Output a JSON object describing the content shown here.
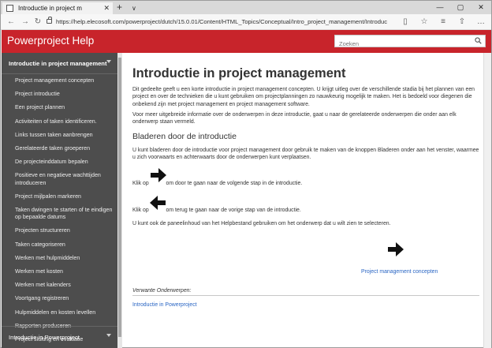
{
  "browser": {
    "tab_title": "Introductie in project m",
    "tab_close": "✕",
    "new_tab": "+",
    "tab_list": "∨",
    "url": "https://help.elecosoft.com/powerproject/dutch/15.0.01/Content/HTML_Topics/Conceptual/Intro_project_management/Introduction_to_project_m",
    "nav": {
      "back": "←",
      "forward": "→",
      "refresh": "↻"
    },
    "tools": {
      "reading": "▯",
      "favorite": "☆",
      "collections": "≡",
      "share": "⇧",
      "more": "…"
    },
    "window": {
      "minimize": "—",
      "maximize": "▢",
      "close": "✕"
    }
  },
  "site": {
    "title": "Powerproject Help",
    "search_placeholder": "Zoeken"
  },
  "sidebar": {
    "section_title": "Introductie in project management",
    "items": [
      "Project management concepten",
      "Project introductie",
      "Een project plannen",
      "Activiteiten of taken identificeren.",
      "Links tussen taken aanbrengen",
      "Gerelateerde taken groeperen",
      "De projecteinddatum bepalen",
      "Positieve en negatieve wachttijden introduceren",
      "Project mijlpalen markeren",
      "Taken dwingen te starten of te eindigen op bepaalde datums",
      "Projecten structureren",
      "Taken categoriseren",
      "Werken met hulpmiddelen",
      "Werken met kosten",
      "Werken met kalenders",
      "Voortgang registreren",
      "Hulpmiddelen en kosten levellen",
      "Rapporten produceren",
      "Project sluiting en evaluatie"
    ],
    "bottom_section": "Introductie in Powerproject"
  },
  "main": {
    "title": "Introductie in project management",
    "intro_1": "Dit gedeelte geeft u een korte introductie in project management concepten. U krijgt uitleg over de verschillende stadia bij het plannen van een project en over de technieken die u kunt gebruiken om projectplanningen zo nauwkeurig mogelijk te maken. Het is bedoeld voor diegenen die onbekend zijn met project management en project management software.",
    "intro_2": "Voor meer uitgebreide informatie over de onderwerpen in deze introductie, gaat u naar de gerelateerde onderwerpen die onder aan elk onderwerp staan vermeld.",
    "subheading": "Bladeren door de introductie",
    "browse_text": "U kunt bladeren door de introductie voor project management door gebruik te maken van de knoppen Bladeren onder aan het venster, waarmee u zich voorwaarts en achterwaarts door de onderwerpen kunt verplaatsen.",
    "next_prefix": "Klik op",
    "next_suffix": "om door te gaan naar de volgende stap in de introductie.",
    "prev_prefix": "Klik op",
    "prev_suffix": "om terug te gaan naar de vorige stap van de introductie.",
    "toc_text": "U kunt ook de paneelinhoud van het Helpbestand gebruiken om het onderwerp dat u wilt zien te selecteren.",
    "next_link": "Project management concepten",
    "related_label": "Verwante Onderwerpen:",
    "related_link": "Introductie in Powerproject"
  }
}
